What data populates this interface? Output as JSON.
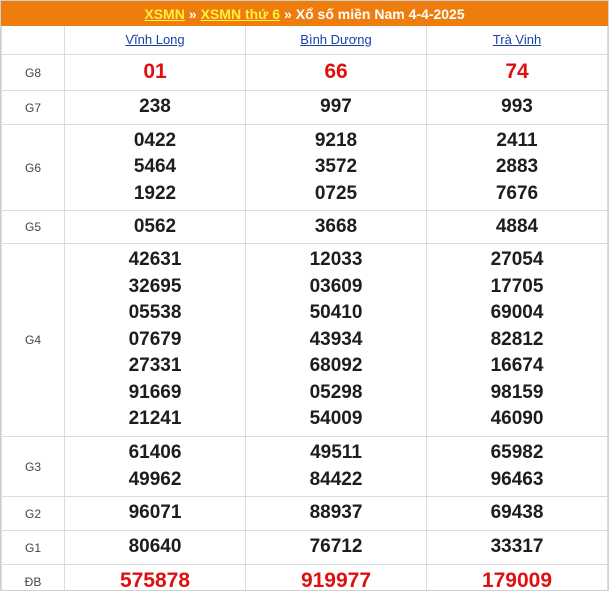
{
  "breadcrumb": {
    "link1": "XSMN",
    "sep1": "»",
    "link2": "XSMN thứ 6",
    "sep2": "»",
    "title": "Xổ số miền Nam 4-4-2025"
  },
  "provinces": [
    "Vĩnh Long",
    "Bình Dương",
    "Trà Vinh"
  ],
  "prizes": [
    {
      "label": "G8",
      "values": [
        [
          "01"
        ],
        [
          "66"
        ],
        [
          "74"
        ]
      ]
    },
    {
      "label": "G7",
      "values": [
        [
          "238"
        ],
        [
          "997"
        ],
        [
          "993"
        ]
      ]
    },
    {
      "label": "G6",
      "values": [
        [
          "0422",
          "5464",
          "1922"
        ],
        [
          "9218",
          "3572",
          "0725"
        ],
        [
          "2411",
          "2883",
          "7676"
        ]
      ]
    },
    {
      "label": "G5",
      "values": [
        [
          "0562"
        ],
        [
          "3668"
        ],
        [
          "4884"
        ]
      ]
    },
    {
      "label": "G4",
      "values": [
        [
          "42631",
          "32695",
          "05538",
          "07679",
          "27331",
          "91669",
          "21241"
        ],
        [
          "12033",
          "03609",
          "50410",
          "43934",
          "68092",
          "05298",
          "54009"
        ],
        [
          "27054",
          "17705",
          "69004",
          "82812",
          "16674",
          "98159",
          "46090"
        ]
      ]
    },
    {
      "label": "G3",
      "values": [
        [
          "61406",
          "49962"
        ],
        [
          "49511",
          "84422"
        ],
        [
          "65982",
          "96463"
        ]
      ]
    },
    {
      "label": "G2",
      "values": [
        [
          "96071"
        ],
        [
          "88937"
        ],
        [
          "69438"
        ]
      ]
    },
    {
      "label": "G1",
      "values": [
        [
          "80640"
        ],
        [
          "76712"
        ],
        [
          "33317"
        ]
      ]
    },
    {
      "label": "ĐB",
      "values": [
        [
          "575878"
        ],
        [
          "919977"
        ],
        [
          "179009"
        ]
      ]
    }
  ],
  "colors": {
    "header_bg": "#ef7d0e",
    "link_yellow": "#fff23a",
    "red_numbers": "#e01010",
    "province_link": "#1a3fa8"
  }
}
